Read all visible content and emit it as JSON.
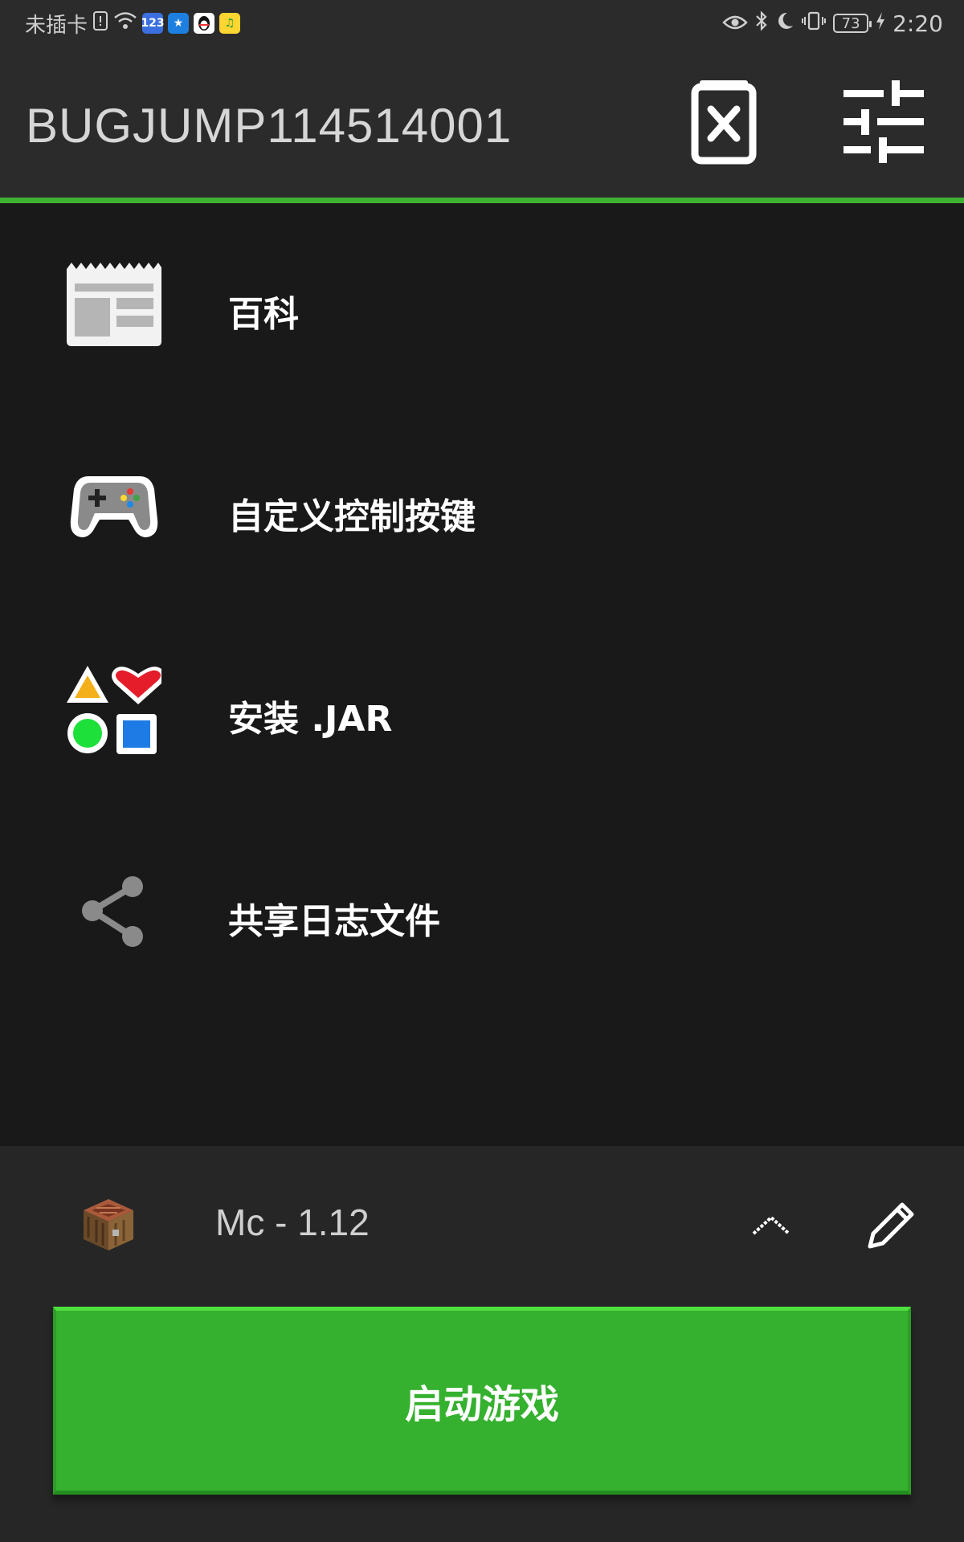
{
  "status_bar": {
    "carrier": "未插卡",
    "time": "2:20",
    "battery": "73",
    "app_icons": [
      "123-app-icon",
      "star-chat-icon",
      "qq-penguin-icon",
      "music-app-icon"
    ]
  },
  "app_bar": {
    "title": "BUGJUMP114514001"
  },
  "menu": {
    "items": [
      {
        "label": "百科",
        "icon": "news-icon"
      },
      {
        "label": "自定义控制按键",
        "icon": "gamepad-icon"
      },
      {
        "label": "安装 .JAR",
        "icon": "shapes-icon"
      },
      {
        "label": "共享日志文件",
        "icon": "share-icon"
      }
    ]
  },
  "version": {
    "label": "Mc - 1.12"
  },
  "launch": {
    "label": "启动游戏"
  },
  "colors": {
    "accent": "#3fb232",
    "button": "#35b02f",
    "background": "#191919",
    "panel": "#262626"
  }
}
